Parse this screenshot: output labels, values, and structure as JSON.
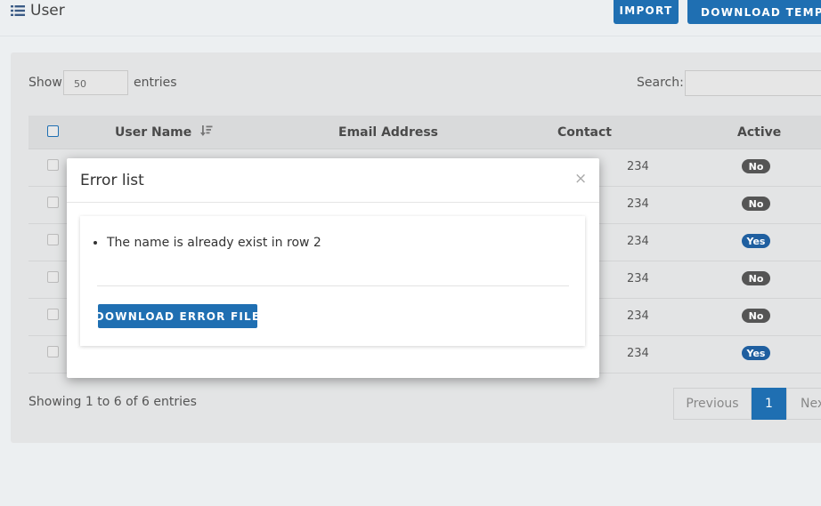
{
  "header": {
    "title": "User",
    "title_icon": "list-icon",
    "import_label": "IMPORT",
    "download_template_label": "DOWNLOAD TEMPL"
  },
  "table_controls": {
    "show_label": "Show",
    "page_length_value": "50",
    "entries_label": "entries",
    "search_label": "Search:",
    "search_value": ""
  },
  "table": {
    "columns": [
      "User Name",
      "Email Address",
      "Contact",
      "Active"
    ],
    "sort_icon": "sort-amount-down-icon",
    "rows": [
      {
        "contact_visible": "234",
        "active": "No"
      },
      {
        "contact_visible": "234",
        "active": "No"
      },
      {
        "contact_visible": "234",
        "active": "Yes"
      },
      {
        "contact_visible": "234",
        "active": "No"
      },
      {
        "contact_visible": "234",
        "active": "No"
      },
      {
        "contact_visible": "234",
        "active": "Yes"
      }
    ]
  },
  "footer": {
    "info": "Showing 1 to 6 of 6 entries",
    "previous_label": "Previous",
    "current_page": "1",
    "next_label": "Nex"
  },
  "modal": {
    "title": "Error list",
    "close_symbol": "×",
    "errors": [
      "The name is already exist in row 2"
    ],
    "download_button_label": "DOWNLOAD ERROR FILE"
  },
  "colors": {
    "primary": "#1f6fb2",
    "badge_no": "#555555",
    "badge_yes": "#1f5fa0"
  }
}
